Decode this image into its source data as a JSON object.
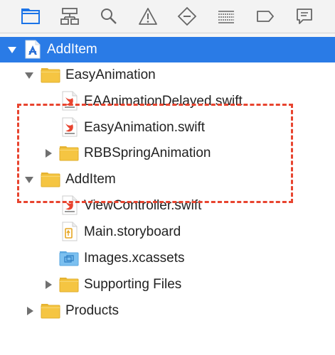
{
  "toolbar": {
    "icons": [
      {
        "name": "project-navigator",
        "active": true
      },
      {
        "name": "symbol-navigator"
      },
      {
        "name": "find-navigator"
      },
      {
        "name": "issue-navigator"
      },
      {
        "name": "test-navigator"
      },
      {
        "name": "debug-navigator"
      },
      {
        "name": "breakpoint-navigator"
      },
      {
        "name": "report-navigator"
      }
    ]
  },
  "tree": {
    "project": {
      "label": "AddItem"
    },
    "easyanimation_group": {
      "label": "EasyAnimation"
    },
    "ea_delayed_file": {
      "label": "EAAnimationDelayed.swift"
    },
    "easyanimation_file": {
      "label": "EasyAnimation.swift"
    },
    "rbb_group": {
      "label": "RBBSpringAnimation"
    },
    "additem_group": {
      "label": "AddItem"
    },
    "viewcontroller_file": {
      "label": "ViewController.swift"
    },
    "main_storyboard_file": {
      "label": "Main.storyboard"
    },
    "images_xcassets": {
      "label": "Images.xcassets"
    },
    "supporting_files_group": {
      "label": "Supporting Files"
    },
    "products_group": {
      "label": "Products"
    }
  },
  "colors": {
    "selection": "#2a7be6",
    "annotation_dash": "#e8442f",
    "folder": "#f5c542",
    "swift_icon": "#e8442f"
  }
}
